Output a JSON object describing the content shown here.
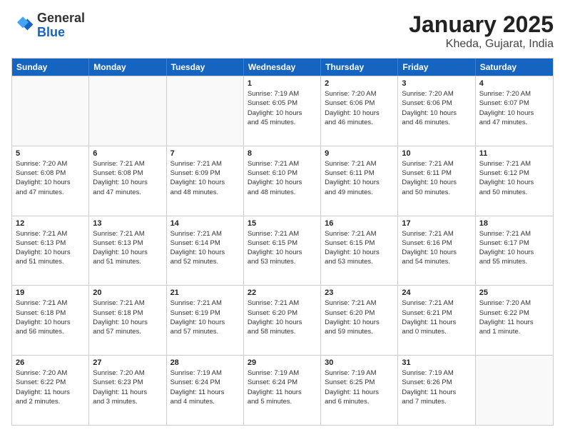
{
  "logo": {
    "general": "General",
    "blue": "Blue"
  },
  "header": {
    "title": "January 2025",
    "subtitle": "Kheda, Gujarat, India"
  },
  "weekdays": [
    "Sunday",
    "Monday",
    "Tuesday",
    "Wednesday",
    "Thursday",
    "Friday",
    "Saturday"
  ],
  "weeks": [
    [
      {
        "day": "",
        "info": ""
      },
      {
        "day": "",
        "info": ""
      },
      {
        "day": "",
        "info": ""
      },
      {
        "day": "1",
        "info": "Sunrise: 7:19 AM\nSunset: 6:05 PM\nDaylight: 10 hours\nand 45 minutes."
      },
      {
        "day": "2",
        "info": "Sunrise: 7:20 AM\nSunset: 6:06 PM\nDaylight: 10 hours\nand 46 minutes."
      },
      {
        "day": "3",
        "info": "Sunrise: 7:20 AM\nSunset: 6:06 PM\nDaylight: 10 hours\nand 46 minutes."
      },
      {
        "day": "4",
        "info": "Sunrise: 7:20 AM\nSunset: 6:07 PM\nDaylight: 10 hours\nand 47 minutes."
      }
    ],
    [
      {
        "day": "5",
        "info": "Sunrise: 7:20 AM\nSunset: 6:08 PM\nDaylight: 10 hours\nand 47 minutes."
      },
      {
        "day": "6",
        "info": "Sunrise: 7:21 AM\nSunset: 6:08 PM\nDaylight: 10 hours\nand 47 minutes."
      },
      {
        "day": "7",
        "info": "Sunrise: 7:21 AM\nSunset: 6:09 PM\nDaylight: 10 hours\nand 48 minutes."
      },
      {
        "day": "8",
        "info": "Sunrise: 7:21 AM\nSunset: 6:10 PM\nDaylight: 10 hours\nand 48 minutes."
      },
      {
        "day": "9",
        "info": "Sunrise: 7:21 AM\nSunset: 6:11 PM\nDaylight: 10 hours\nand 49 minutes."
      },
      {
        "day": "10",
        "info": "Sunrise: 7:21 AM\nSunset: 6:11 PM\nDaylight: 10 hours\nand 50 minutes."
      },
      {
        "day": "11",
        "info": "Sunrise: 7:21 AM\nSunset: 6:12 PM\nDaylight: 10 hours\nand 50 minutes."
      }
    ],
    [
      {
        "day": "12",
        "info": "Sunrise: 7:21 AM\nSunset: 6:13 PM\nDaylight: 10 hours\nand 51 minutes."
      },
      {
        "day": "13",
        "info": "Sunrise: 7:21 AM\nSunset: 6:13 PM\nDaylight: 10 hours\nand 51 minutes."
      },
      {
        "day": "14",
        "info": "Sunrise: 7:21 AM\nSunset: 6:14 PM\nDaylight: 10 hours\nand 52 minutes."
      },
      {
        "day": "15",
        "info": "Sunrise: 7:21 AM\nSunset: 6:15 PM\nDaylight: 10 hours\nand 53 minutes."
      },
      {
        "day": "16",
        "info": "Sunrise: 7:21 AM\nSunset: 6:15 PM\nDaylight: 10 hours\nand 53 minutes."
      },
      {
        "day": "17",
        "info": "Sunrise: 7:21 AM\nSunset: 6:16 PM\nDaylight: 10 hours\nand 54 minutes."
      },
      {
        "day": "18",
        "info": "Sunrise: 7:21 AM\nSunset: 6:17 PM\nDaylight: 10 hours\nand 55 minutes."
      }
    ],
    [
      {
        "day": "19",
        "info": "Sunrise: 7:21 AM\nSunset: 6:18 PM\nDaylight: 10 hours\nand 56 minutes."
      },
      {
        "day": "20",
        "info": "Sunrise: 7:21 AM\nSunset: 6:18 PM\nDaylight: 10 hours\nand 57 minutes."
      },
      {
        "day": "21",
        "info": "Sunrise: 7:21 AM\nSunset: 6:19 PM\nDaylight: 10 hours\nand 57 minutes."
      },
      {
        "day": "22",
        "info": "Sunrise: 7:21 AM\nSunset: 6:20 PM\nDaylight: 10 hours\nand 58 minutes."
      },
      {
        "day": "23",
        "info": "Sunrise: 7:21 AM\nSunset: 6:20 PM\nDaylight: 10 hours\nand 59 minutes."
      },
      {
        "day": "24",
        "info": "Sunrise: 7:21 AM\nSunset: 6:21 PM\nDaylight: 11 hours\nand 0 minutes."
      },
      {
        "day": "25",
        "info": "Sunrise: 7:20 AM\nSunset: 6:22 PM\nDaylight: 11 hours\nand 1 minute."
      }
    ],
    [
      {
        "day": "26",
        "info": "Sunrise: 7:20 AM\nSunset: 6:22 PM\nDaylight: 11 hours\nand 2 minutes."
      },
      {
        "day": "27",
        "info": "Sunrise: 7:20 AM\nSunset: 6:23 PM\nDaylight: 11 hours\nand 3 minutes."
      },
      {
        "day": "28",
        "info": "Sunrise: 7:19 AM\nSunset: 6:24 PM\nDaylight: 11 hours\nand 4 minutes."
      },
      {
        "day": "29",
        "info": "Sunrise: 7:19 AM\nSunset: 6:24 PM\nDaylight: 11 hours\nand 5 minutes."
      },
      {
        "day": "30",
        "info": "Sunrise: 7:19 AM\nSunset: 6:25 PM\nDaylight: 11 hours\nand 6 minutes."
      },
      {
        "day": "31",
        "info": "Sunrise: 7:19 AM\nSunset: 6:26 PM\nDaylight: 11 hours\nand 7 minutes."
      },
      {
        "day": "",
        "info": ""
      }
    ]
  ]
}
